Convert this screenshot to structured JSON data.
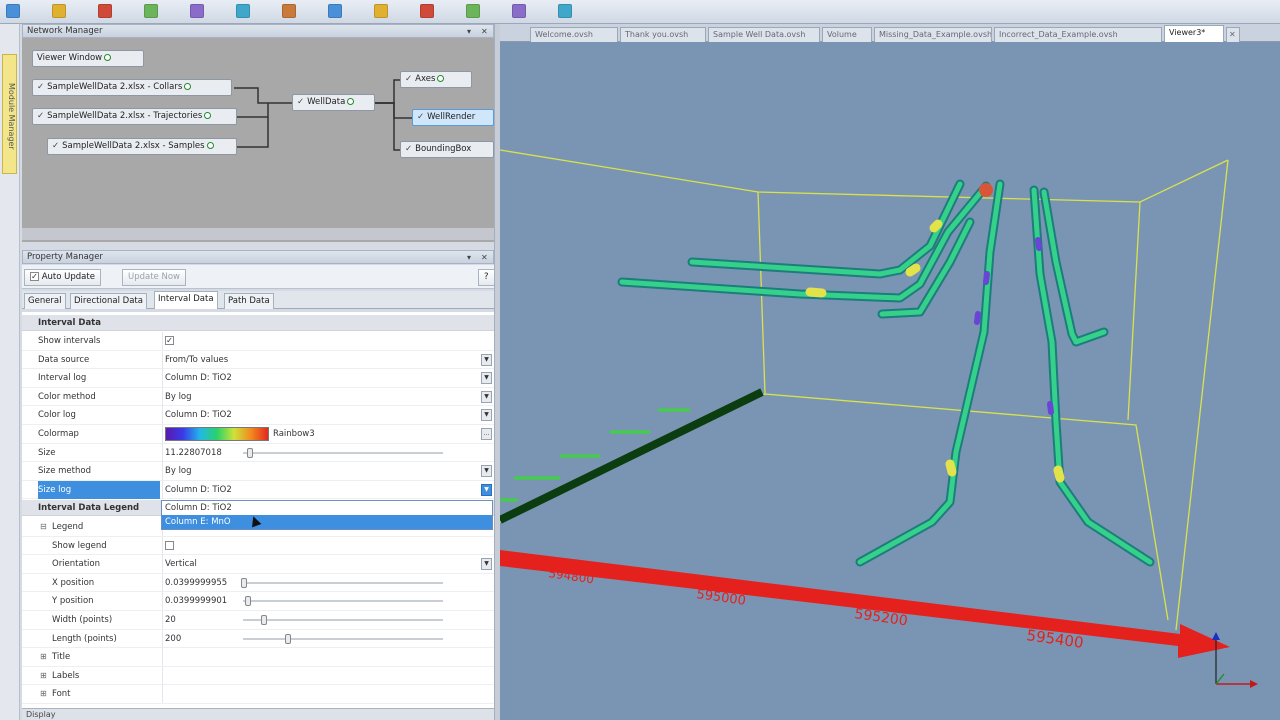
{
  "toolbar": {
    "icons": [
      "open-icon",
      "save-icon",
      "folder-icon",
      "print-icon",
      "undo-icon",
      "redo-icon",
      "zoom-icon",
      "pan-icon",
      "rotate-icon",
      "layers-icon",
      "settings-icon",
      "export-icon",
      "help-icon"
    ]
  },
  "module_manager": {
    "label": "Module Manager"
  },
  "network_manager": {
    "title": "Network Manager",
    "nodes": [
      {
        "label": "Viewer Window",
        "checked": false
      },
      {
        "label": "SampleWellData 2.xlsx - Collars",
        "checked": true
      },
      {
        "label": "SampleWellData 2.xlsx - Trajectories",
        "checked": true
      },
      {
        "label": "SampleWellData 2.xlsx - Samples",
        "checked": true
      },
      {
        "label": "WellData",
        "checked": true
      },
      {
        "label": "Axes",
        "checked": true
      },
      {
        "label": "WellRender",
        "checked": true
      },
      {
        "label": "BoundingBox",
        "checked": true
      }
    ]
  },
  "property_manager": {
    "title": "Property Manager",
    "auto_update_label": "Auto Update",
    "update_now_label": "Update Now",
    "help_label": "?",
    "tabs": [
      "General",
      "Directional Data",
      "Interval Data",
      "Path Data"
    ],
    "active_tab": "Interval Data",
    "interval_section": "Interval Data",
    "rows": [
      {
        "label": "Show intervals",
        "value": "",
        "checked": true
      },
      {
        "label": "Data source",
        "value": "From/To values"
      },
      {
        "label": "Interval log",
        "value": "Column D: TiO2"
      },
      {
        "label": "Color method",
        "value": "By log"
      },
      {
        "label": "Color log",
        "value": "Column D: TiO2"
      },
      {
        "label": "Colormap",
        "value": "Rainbow3"
      },
      {
        "label": "Size",
        "value": "11.22807018"
      },
      {
        "label": "Size method",
        "value": "By log"
      },
      {
        "label": "Size log",
        "value": "Column D: TiO2"
      }
    ],
    "legend_section": "Interval Data Legend",
    "legend_rows": [
      {
        "label": "Legend",
        "value": ""
      },
      {
        "label": "Show legend",
        "value": ""
      },
      {
        "label": "Orientation",
        "value": "Vertical"
      },
      {
        "label": "X position",
        "value": "0.0399999955"
      },
      {
        "label": "Y position",
        "value": "0.0399999901"
      },
      {
        "label": "Width (points)",
        "value": "20"
      },
      {
        "label": "Length (points)",
        "value": "200"
      },
      {
        "label": "Title",
        "value": ""
      },
      {
        "label": "Labels",
        "value": ""
      },
      {
        "label": "Font",
        "value": ""
      }
    ],
    "dropdown_options": [
      "Column D: TiO2",
      "Column E: MnO"
    ],
    "status": "Display"
  },
  "viewer": {
    "tabs": [
      "Welcome.ovsh",
      "Thank you.ovsh",
      "Sample Well Data.ovsh",
      "Volume",
      "Missing_Data_Example.ovsh",
      "Incorrect_Data_Example.ovsh",
      "Viewer3*"
    ],
    "active_tab": "Viewer3*",
    "axis_labels": [
      "594800",
      "595000",
      "595200",
      "595400"
    ],
    "axis_color": "#e4211d",
    "box_color": "#d9e24a"
  }
}
